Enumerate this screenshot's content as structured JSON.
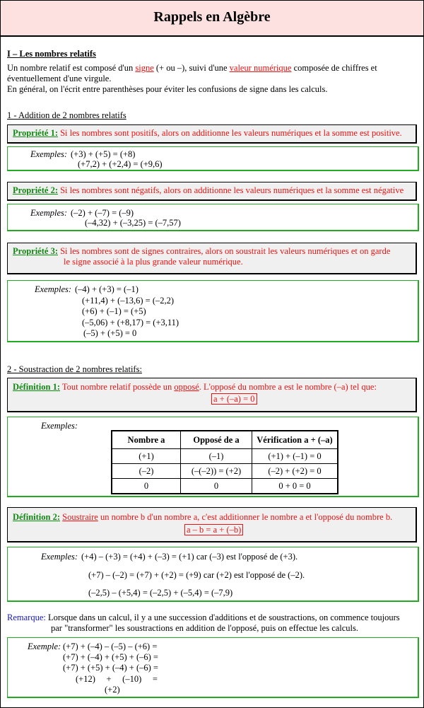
{
  "title": "Rappels en Algèbre",
  "section1": {
    "heading": "I – Les nombres relatifs",
    "para1_a": "Un nombre relatif est composé d'un ",
    "para1_signe": "signe",
    "para1_b": " (+ ou –),  suivi d'une ",
    "para1_valeur": "valeur numérique",
    "para1_c": " composée de chiffres et",
    "para1_line2": "éventuellement d'une virgule.",
    "para2": "En général, on l'écrit entre parenthèses pour éviter les confusions de signe dans les calculs."
  },
  "addition": {
    "heading": "1 - Addition de 2 nombres relatifs",
    "prop1": {
      "label": "Propriété 1:",
      "text": " Si les nombres sont positifs, alors on additionne les valeurs numériques et la somme est positive.",
      "examples_label": "Exemples:",
      "examples": [
        "(+3) + (+5) = (+8)",
        "(+7,2) + (+2,4) = (+9,6)"
      ]
    },
    "prop2": {
      "label": "Propriété 2:",
      "text": " Si les nombres sont négatifs, alors on additionne les valeurs numériques et la somme est négative",
      "examples_label": "Exemples:",
      "examples": [
        "(–2) + (–7) = (–9)",
        "(–4,32) + (–3,25) = (–7,57)"
      ]
    },
    "prop3": {
      "label": "Propriété 3:",
      "text_line1": " Si les nombres  sont de signes contraires, alors on soustrait les valeurs numériques et on garde",
      "text_line2": "le signe associé à la plus grande valeur numérique.",
      "examples_label": "Exemples:",
      "examples": [
        "(–4) + (+3) = (–1)",
        "(+11,4) + (–13,6) = (–2,2)",
        "(+6) + (–1) = (+5)",
        "(–5,06) + (+8,17) = (+3,11)",
        "(–5) + (+5) = 0"
      ]
    }
  },
  "soustraction": {
    "heading": "2 - Soustraction de 2 nombres relatifs:",
    "def1": {
      "label": "Définition 1:",
      "text_a": " Tout nombre relatif possède un ",
      "text_oppose": "opposé",
      "text_b": ". L'opposé du nombre a est le nombre (–a) tel que:",
      "formula": "a + (–a) = 0",
      "examples_label": "Exemples:",
      "table": {
        "headers": [
          "Nombre a",
          "Opposé de a",
          "Vérification a + (–a)"
        ],
        "rows": [
          [
            "(+1)",
            "(–1)",
            "(+1) + (–1) = 0"
          ],
          [
            "(–2)",
            "(–(–2)) = (+2)",
            "(–2) + (+2) = 0"
          ],
          [
            "0",
            "0",
            "0 + 0 = 0"
          ]
        ]
      }
    },
    "def2": {
      "label": "Définition 2:",
      "text_soustraire": "Soustraire",
      "text_rest": " un nombre b d'un nombre a, c'est additionner le nombre a et l'opposé du nombre b.",
      "formula": "a – b = a + (–b)",
      "examples_label": "Exemples:",
      "examples": [
        "(+4) – (+3) = (+4) + (–3) = (+1)  car (–3) est l'opposé de (+3).",
        "(+7) – (–2) = (+7) + (+2) = (+9)  car (+2) est l'opposé de (–2).",
        "(–2,5) – (+5,4) = (–2,5) + (–5,4) = (–7,9)"
      ]
    },
    "remarque": {
      "label": "Remarque:",
      "line1": " Lorsque dans un calcul, il y a une succession d'additions et de soustractions, on commence toujours",
      "line2": "par \"transformer\" les soustractions en addition de l'opposé, puis on effectue les calculs.",
      "example_label": "Exemple:",
      "example_lines": [
        "(+7) + (–4) – (–5) – (+6) =",
        "(+7) + (–4) + (+5) + (–6) =",
        "(+7) + (+5) + (–4) + (–6) =",
        "(+12)     +     (–10)     =",
        "(+2)"
      ]
    }
  },
  "colors": {
    "title_bg": "#fde1e1",
    "label_green": "#118811",
    "text_red": "#ee1111",
    "remarque_blue": "#1515d0",
    "example_border": "#22aa22",
    "prop_bg": "#f0f0f0"
  }
}
